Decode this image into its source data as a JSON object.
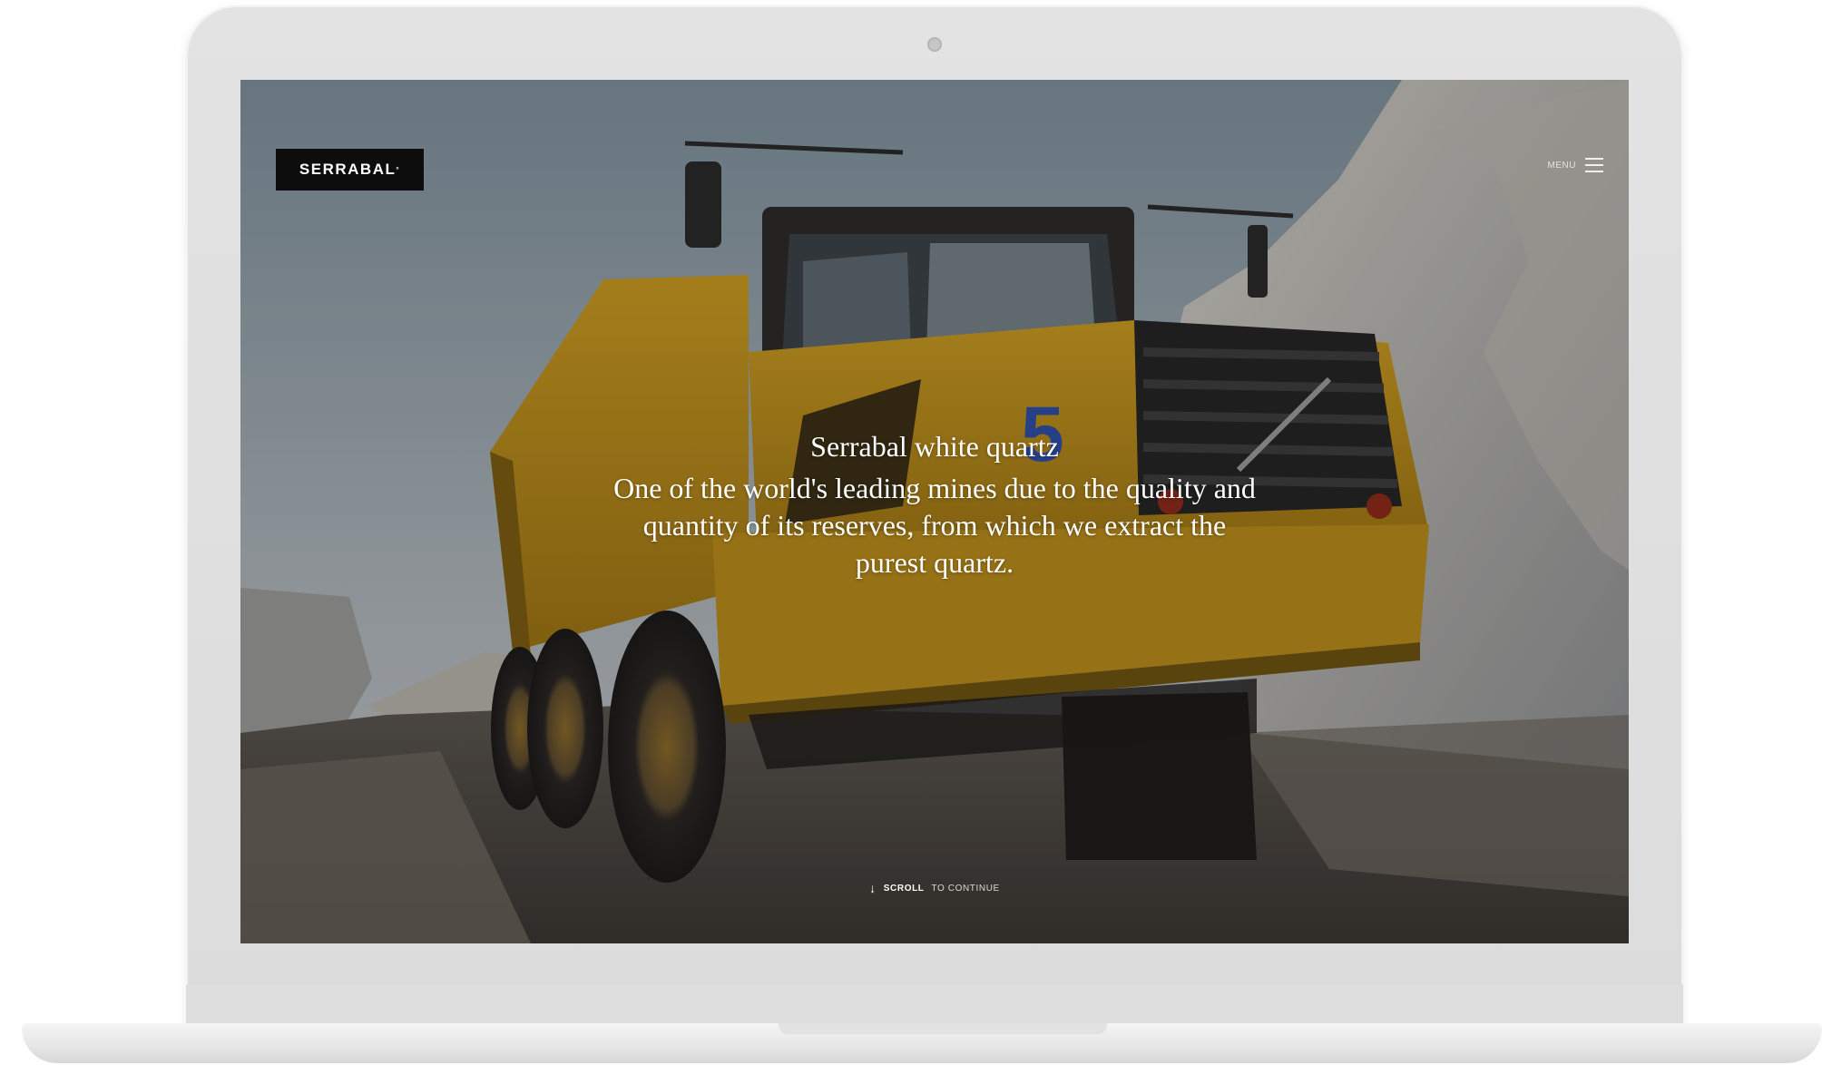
{
  "brand": {
    "logo_text": "SERRABAL",
    "logo_mark": "°"
  },
  "nav": {
    "menu_label": "MENU",
    "menu_icon": "hamburger-icon"
  },
  "hero": {
    "title": "Serrabal white quartz",
    "body": "One of the world's leading mines due to the quality and quantity of its reserves, from which we extract the purest quartz.",
    "truck_number": "5"
  },
  "scroll_cue": {
    "icon": "arrow-down-icon",
    "strong_text": "SCROLL",
    "light_text": "TO CONTINUE"
  },
  "colors": {
    "device_frame": "#e0e0e0",
    "logo_background": "#0d0d0d",
    "truck_yellow": "#c8981f",
    "hero_text": "#ffffff"
  }
}
